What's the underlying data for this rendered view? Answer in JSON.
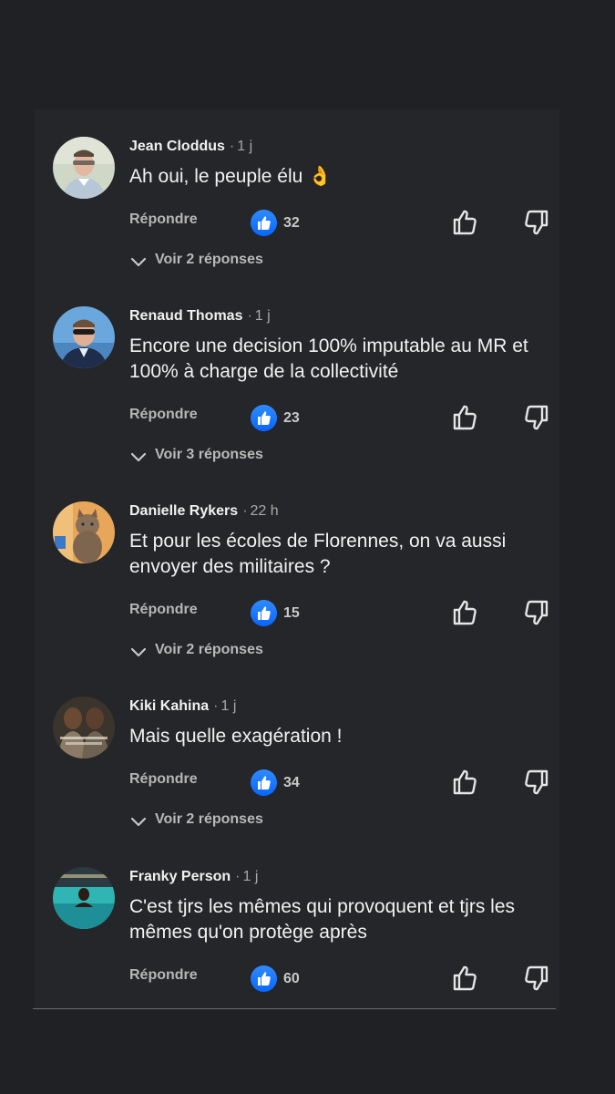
{
  "comments": [
    {
      "author": "Jean Cloddus",
      "time": "1 j",
      "text": "Ah oui, le peuple élu 👌",
      "reply_label": "Répondre",
      "likes": "32",
      "replies_label": "Voir 2 réponses"
    },
    {
      "author": "Renaud Thomas",
      "time": "1 j",
      "text": "Encore une decision 100% imputable au MR et 100% à charge de la collectivité",
      "reply_label": "Répondre",
      "likes": "23",
      "replies_label": "Voir 3 réponses"
    },
    {
      "author": "Danielle Rykers",
      "time": "22 h",
      "text": "Et pour les écoles de Florennes, on va aussi envoyer des militaires ?",
      "reply_label": "Répondre",
      "likes": "15",
      "replies_label": "Voir 2 réponses"
    },
    {
      "author": "Kiki Kahina",
      "time": "1 j",
      "text": "Mais quelle exagération !",
      "reply_label": "Répondre",
      "likes": "34",
      "replies_label": "Voir 2 réponses"
    },
    {
      "author": "Franky Person",
      "time": "1 j",
      "text": "C'est tjrs les mêmes qui provoquent et tjrs les mêmes qu'on protège après",
      "reply_label": "Répondre",
      "likes": "60"
    }
  ],
  "separator": "·",
  "icons": {
    "like_badge": "like-reaction-icon",
    "thumb_up": "thumbs-up-outline-icon",
    "thumb_down": "thumbs-down-outline-icon",
    "chevron": "chevron-down-icon"
  },
  "colors": {
    "background": "#202124",
    "panel": "#252629",
    "like_blue": "#0866ff"
  }
}
